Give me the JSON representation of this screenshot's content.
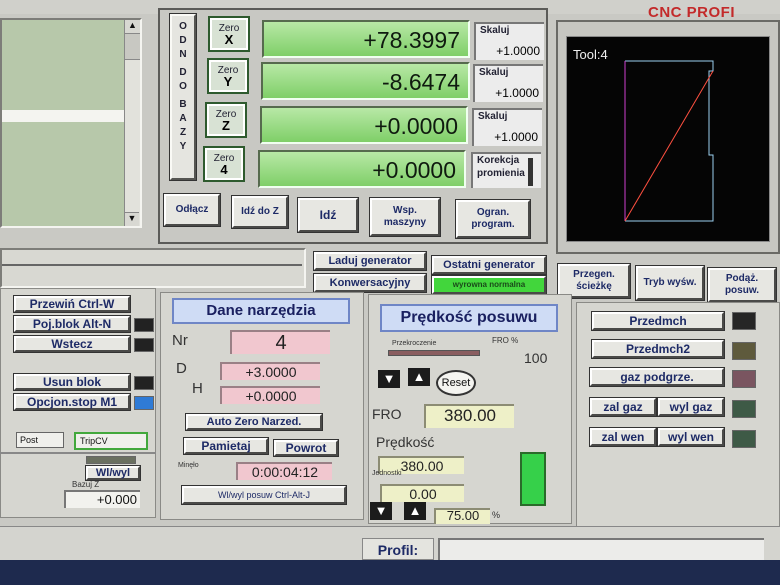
{
  "header": {
    "brand": "CNC PROFI"
  },
  "zero_buttons": [
    {
      "top": "Zero",
      "axis": "X"
    },
    {
      "top": "Zero",
      "axis": "Y"
    },
    {
      "top": "Zero",
      "axis": "Z"
    },
    {
      "top": "Zero",
      "axis": "4"
    }
  ],
  "ref_label": [
    "O",
    "D",
    "N",
    "",
    "D",
    "O",
    "",
    "B",
    "A",
    "Z",
    "Y"
  ],
  "dro_values": [
    "+78.3997",
    "-8.6474",
    "+0.0000",
    "+0.0000"
  ],
  "scale": [
    {
      "label": "Skaluj",
      "value": "+1.0000"
    },
    {
      "label": "Skaluj",
      "value": "+1.0000"
    },
    {
      "label": "Skaluj",
      "value": "+1.0000"
    }
  ],
  "radius_comp": {
    "line1": "Korekcja",
    "line2": "promienia"
  },
  "axis_buttons": {
    "odlacz": "Odłącz",
    "idz_do_z": "Idź do Z",
    "idz": "Idź",
    "wsp_maszyny": "Wsp. maszyny",
    "ogran_program": "Ogran. program."
  },
  "tool_view": {
    "label": "Tool:4"
  },
  "generator": {
    "laduj": "Laduj generator",
    "ostatni": "Ostatni generator",
    "konwersacyjny": "Konwersacyjny",
    "normal_btn": "wyrowna normalna"
  },
  "view_buttons": {
    "przegen": "Przegen. ścieżkę",
    "tryb": "Tryb wyśw.",
    "podaz": "Podąż. posuw."
  },
  "left_controls": {
    "przewin": "Przewiń Ctrl-W",
    "poj_blok": "Poj.blok Alt-N",
    "wstecz": "Wstecz",
    "usun_blok": "Usun blok",
    "opcjon_stop": "Opcjon.stop M1",
    "post": "Post",
    "trip": "TripCV",
    "wl_wyl": "Wl/wyl",
    "bazuj_z": "Bazuj Z",
    "bazuj_value": "+0.000"
  },
  "tool_data": {
    "title": "Dane narzędzia",
    "nr_label": "Nr",
    "nr_value": "4",
    "d_label": "D",
    "d_value": "+3.0000",
    "h_label": "H",
    "h_value": "+0.0000",
    "auto_zero": "Auto Zero Narzed.",
    "pamietaj": "Pamietaj",
    "powrot": "Powrot",
    "time_label": "Minęło",
    "time_value": "0:00:04:12",
    "feed_toggle": "Wl/wyl posuw Ctrl-Alt-J"
  },
  "feed": {
    "title": "Prędkość posuwu",
    "override_label": "Przekroczenie",
    "fro_pct_label": "FRO %",
    "fro_pct_value": "100",
    "reset": "Reset",
    "fro_label": "FRO",
    "fro_value": "380.00",
    "speed_label": "Prędkość",
    "speed_value": "380.00",
    "units_label": "Jednostki",
    "units_value": "0.00",
    "step_value": "75.00",
    "step_unit": "%"
  },
  "outputs": [
    {
      "label": "Przedmch",
      "led": "#262626"
    },
    {
      "label": "Przedmch2",
      "led": "#5e5a3c"
    },
    {
      "label": "gaz podgrze.",
      "led": "#7a5560"
    },
    {
      "label": "zal gaz",
      "label2": "wyl gaz",
      "led": "#3e5a46"
    },
    {
      "label": "zal wen",
      "label2": "wyl wen",
      "led": "#3e5a46"
    }
  ],
  "footer": {
    "profile_label": "Profil:"
  }
}
